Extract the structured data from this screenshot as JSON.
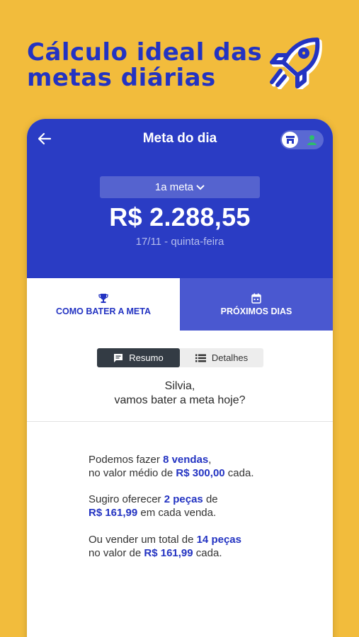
{
  "promo": {
    "title_line1": "Cálculo ideal das",
    "title_line2": "metas diárias",
    "icon": "rocket-icon"
  },
  "colors": {
    "background": "#F2BC3C",
    "brand_blue": "#2A3CC4",
    "tab_inactive": "#4A58D0",
    "highlight": "#2333C2"
  },
  "app_header": {
    "title": "Meta do dia",
    "back_icon": "arrow-left-icon",
    "toggle_icons": [
      "store-icon",
      "person-icon"
    ]
  },
  "goal": {
    "selector": "1a meta",
    "amount": "R$ 2.288,55",
    "date": "17/11 - quinta-feira"
  },
  "tabs": [
    {
      "label": "COMO BATER A META",
      "icon": "trophy-icon",
      "active": true
    },
    {
      "label": "PRÓXIMOS DIAS",
      "icon": "calendar-icon",
      "active": false
    }
  ],
  "segment": {
    "summary": "Resumo",
    "details": "Detalhes",
    "selected": "Resumo"
  },
  "greeting": {
    "line1": "Silvia,",
    "line2": "vamos bater a meta hoje?"
  },
  "tips": {
    "t1_a": "Podemos fazer ",
    "t1_b": "8 vendas",
    "t1_c": ",",
    "t1_d": "no valor médio de ",
    "t1_e": "R$ 300,00",
    "t1_f": " cada.",
    "t2_a": "Sugiro oferecer ",
    "t2_b": "2 peças",
    "t2_c": " de",
    "t2_d": "R$ 161,99",
    "t2_e": " em cada venda.",
    "t3_a": "Ou vender um total de ",
    "t3_b": "14 peças",
    "t3_c": "no valor de ",
    "t3_d": "R$ 161,99",
    "t3_e": " cada."
  }
}
